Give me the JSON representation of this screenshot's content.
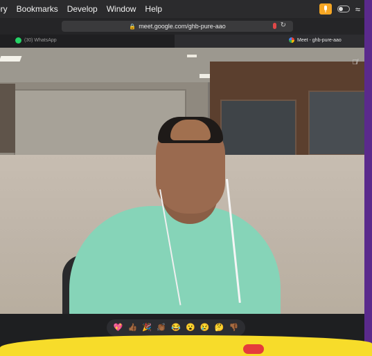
{
  "menubar": {
    "items": [
      "ory",
      "Bookmarks",
      "Develop",
      "Window",
      "Help"
    ]
  },
  "browser": {
    "url": "meet.google.com/ghb-pure-aao",
    "tabs": [
      {
        "label": "(30) WhatsApp"
      },
      {
        "label": "Meet - ghb-pure-aao"
      }
    ]
  },
  "reactions": [
    "💖",
    "👍🏾",
    "🎉",
    "👏🏾",
    "😂",
    "😮",
    "😢",
    "🤔",
    "👎🏾"
  ],
  "colors": {
    "accent": "#f6a623",
    "frame": "#5a2a8c",
    "banner": "#f7dc2a"
  }
}
